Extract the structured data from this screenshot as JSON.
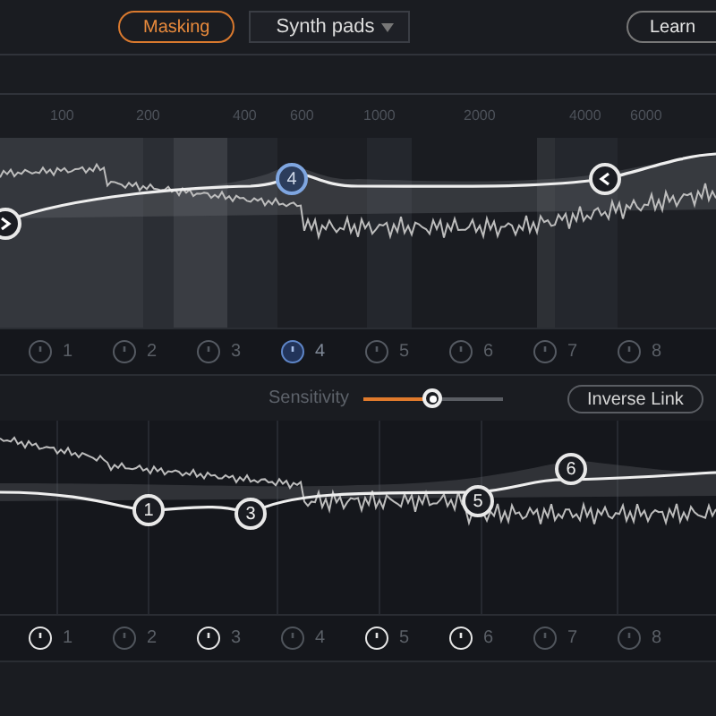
{
  "header": {
    "mode_button": {
      "label": "Masking",
      "selected": true
    },
    "preset": {
      "value": "Synth pads"
    },
    "learn_button": {
      "label": "Learn"
    }
  },
  "frequency_labels": [
    "100",
    "200",
    "400",
    "600",
    "1000",
    "2000",
    "4000",
    "6000"
  ],
  "top_eq": {
    "nodes": [
      {
        "kind": "low-shelf"
      },
      {
        "kind": "bell",
        "label": "4",
        "selected": true
      },
      {
        "kind": "high-shelf"
      }
    ],
    "bands": [
      {
        "label": "1",
        "selected": false
      },
      {
        "label": "2",
        "selected": false
      },
      {
        "label": "3",
        "selected": false
      },
      {
        "label": "4",
        "selected": true
      },
      {
        "label": "5",
        "selected": false
      },
      {
        "label": "6",
        "selected": false
      },
      {
        "label": "7",
        "selected": false
      },
      {
        "label": "8",
        "selected": false
      }
    ]
  },
  "sensitivity": {
    "label": "Sensitivity",
    "level": 0.49
  },
  "inverse_link_button": {
    "label": "Inverse Link"
  },
  "bottom_eq": {
    "nodes": [
      {
        "kind": "bell",
        "label": "1",
        "selected": false
      },
      {
        "kind": "bell",
        "label": "3",
        "selected": false
      },
      {
        "kind": "bell",
        "label": "5",
        "selected": false
      },
      {
        "kind": "bell",
        "label": "6",
        "selected": false
      }
    ],
    "bands": [
      {
        "label": "1",
        "on": true
      },
      {
        "label": "2",
        "on": false
      },
      {
        "label": "3",
        "on": true
      },
      {
        "label": "4",
        "on": false
      },
      {
        "label": "5",
        "on": true
      },
      {
        "label": "6",
        "on": true
      },
      {
        "label": "7",
        "on": false
      },
      {
        "label": "8",
        "on": false
      }
    ]
  }
}
